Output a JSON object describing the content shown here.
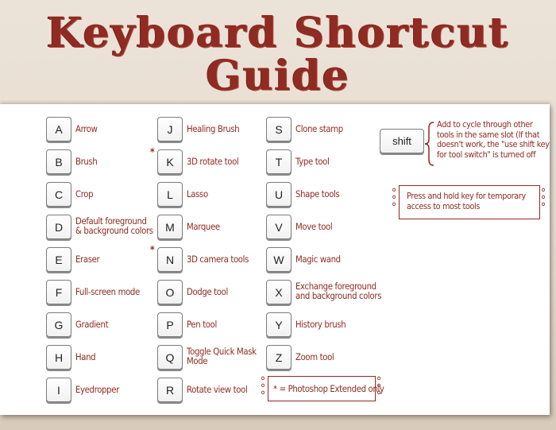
{
  "title": {
    "line1": "Keyboard Shortcut",
    "line2": "Guide"
  },
  "colors": {
    "accent": "#8f2b22",
    "background": "#e8ddd0",
    "card": "#ffffff"
  },
  "columns": [
    {
      "shortcuts": [
        {
          "key": "A",
          "label": [
            "Arrow"
          ],
          "extended": false
        },
        {
          "key": "B",
          "label": [
            "Brush"
          ],
          "extended": false
        },
        {
          "key": "C",
          "label": [
            "Crop"
          ],
          "extended": false
        },
        {
          "key": "D",
          "label": [
            "Default foreground",
            "& background colors"
          ],
          "extended": false
        },
        {
          "key": "E",
          "label": [
            "Eraser"
          ],
          "extended": false
        },
        {
          "key": "F",
          "label": [
            "Full-screen mode"
          ],
          "extended": false
        },
        {
          "key": "G",
          "label": [
            "Gradient"
          ],
          "extended": false
        },
        {
          "key": "H",
          "label": [
            "Hand"
          ],
          "extended": false
        },
        {
          "key": "I",
          "label": [
            "Eyedropper"
          ],
          "extended": false
        }
      ]
    },
    {
      "shortcuts": [
        {
          "key": "J",
          "label": [
            "Healing Brush"
          ],
          "extended": false
        },
        {
          "key": "K",
          "label": [
            "3D rotate tool"
          ],
          "extended": true
        },
        {
          "key": "L",
          "label": [
            "Lasso"
          ],
          "extended": false
        },
        {
          "key": "M",
          "label": [
            "Marquee"
          ],
          "extended": false
        },
        {
          "key": "N",
          "label": [
            "3D camera tools"
          ],
          "extended": true
        },
        {
          "key": "O",
          "label": [
            "Dodge tool"
          ],
          "extended": false
        },
        {
          "key": "P",
          "label": [
            "Pen tool"
          ],
          "extended": false
        },
        {
          "key": "Q",
          "label": [
            "Toggle Quick Mask",
            "Mode"
          ],
          "extended": false
        },
        {
          "key": "R",
          "label": [
            "Rotate view tool"
          ],
          "extended": false
        }
      ]
    },
    {
      "shortcuts": [
        {
          "key": "S",
          "label": [
            "Clone stamp"
          ],
          "extended": false
        },
        {
          "key": "T",
          "label": [
            "Type tool"
          ],
          "extended": false
        },
        {
          "key": "U",
          "label": [
            "Shape tools"
          ],
          "extended": false
        },
        {
          "key": "V",
          "label": [
            "Move tool"
          ],
          "extended": false
        },
        {
          "key": "W",
          "label": [
            "Magic wand"
          ],
          "extended": false
        },
        {
          "key": "X",
          "label": [
            "Exchange foreground",
            "and background colors"
          ],
          "extended": false
        },
        {
          "key": "Y",
          "label": [
            "History brush"
          ],
          "extended": false
        },
        {
          "key": "Z",
          "label": [
            "Zoom tool"
          ],
          "extended": false
        }
      ]
    }
  ],
  "star_marker": "*",
  "shift": {
    "key": "shift",
    "note": [
      "Add to cycle through other",
      "tools in the same slot (If that",
      "doesn't work, the \"use shift key",
      "for tool switch\" is turned off"
    ]
  },
  "hold_note": [
    "Press and hold key for temporary",
    "access to most tools"
  ],
  "extended_note": "* = Photoshop Extended only"
}
